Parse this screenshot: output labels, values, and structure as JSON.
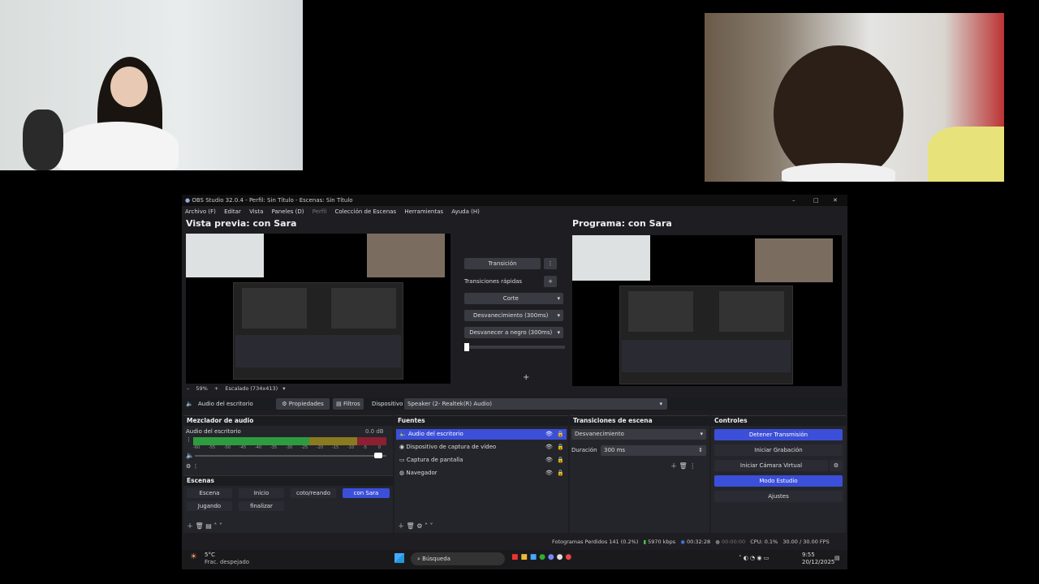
{
  "window": {
    "title": "OBS Studio 32.0.4 - Perfil: Sin Título - Escenas: Sin Título",
    "min": "–",
    "max": "□",
    "close": "✕"
  },
  "menu": [
    "Archivo (F)",
    "Editar",
    "Vista",
    "Paneles (D)",
    "Perfil",
    "Colección de Escenas",
    "Herramientas",
    "Ayuda (H)"
  ],
  "preview": {
    "title": "Vista previa: con Sara",
    "zoom": "59%",
    "canvas": "Escalado (734x413)"
  },
  "program": {
    "title": "Programa: con Sara"
  },
  "transition_center": {
    "button": "Transición",
    "quick_label": "Transiciones rápidas",
    "options": [
      "Corte",
      "Desvanecimiento (300ms)",
      "Desvanecer a negro (300ms)"
    ]
  },
  "source_bar": {
    "source": "Audio del escritorio",
    "props": "Propiedades",
    "filters": "Filtros",
    "device_label": "Dispositivo",
    "device_value": "Speaker (2- Realtek(R) Audio)"
  },
  "mixer": {
    "title": "Mezclador de audio",
    "track": "Audio del escritorio",
    "db": "0.0 dB",
    "ticks": [
      "-60",
      "-55",
      "-50",
      "-45",
      "-40",
      "-35",
      "-30",
      "-25",
      "-20",
      "-15",
      "-10",
      "-5",
      "0"
    ],
    "level": 0.98
  },
  "scenes": {
    "title": "Escenas",
    "items": [
      "Escena",
      "Inicio",
      "coto/reando",
      "con Sara",
      "Jugando",
      "finalizar"
    ],
    "selected": "con Sara"
  },
  "sources": {
    "title": "Fuentes",
    "items": [
      "Audio del escritorio",
      "Dispositivo de captura de vídeo",
      "Captura de pantalla",
      "Navegador"
    ]
  },
  "scene_transitions": {
    "title": "Transiciones de escena",
    "type": "Desvanecimiento",
    "duration_label": "Duración",
    "duration_value": "300 ms"
  },
  "controls": {
    "title": "Controles",
    "buttons": [
      "Detener Transmisión",
      "Iniciar Grabación",
      "Iniciar Cámara Virtual",
      "Modo Estudio",
      "Ajustes"
    ]
  },
  "status": {
    "dropped": "Fotogramas Perdidos 141 (0.2%)",
    "kbps": "5970 kbps",
    "stream_time": "00:32:28",
    "rec_time": "00:00:00",
    "cpu": "CPU: 0.1%",
    "fps": "30.00 / 30.00 FPS"
  },
  "taskbar": {
    "weather_temp": "5°C",
    "weather_desc": "Frac. despejado",
    "search": "Búsqueda",
    "time": "9:55",
    "date": "20/12/2025"
  },
  "colors": {
    "accent": "#3b4fd9",
    "bg": "#1e1e22"
  }
}
